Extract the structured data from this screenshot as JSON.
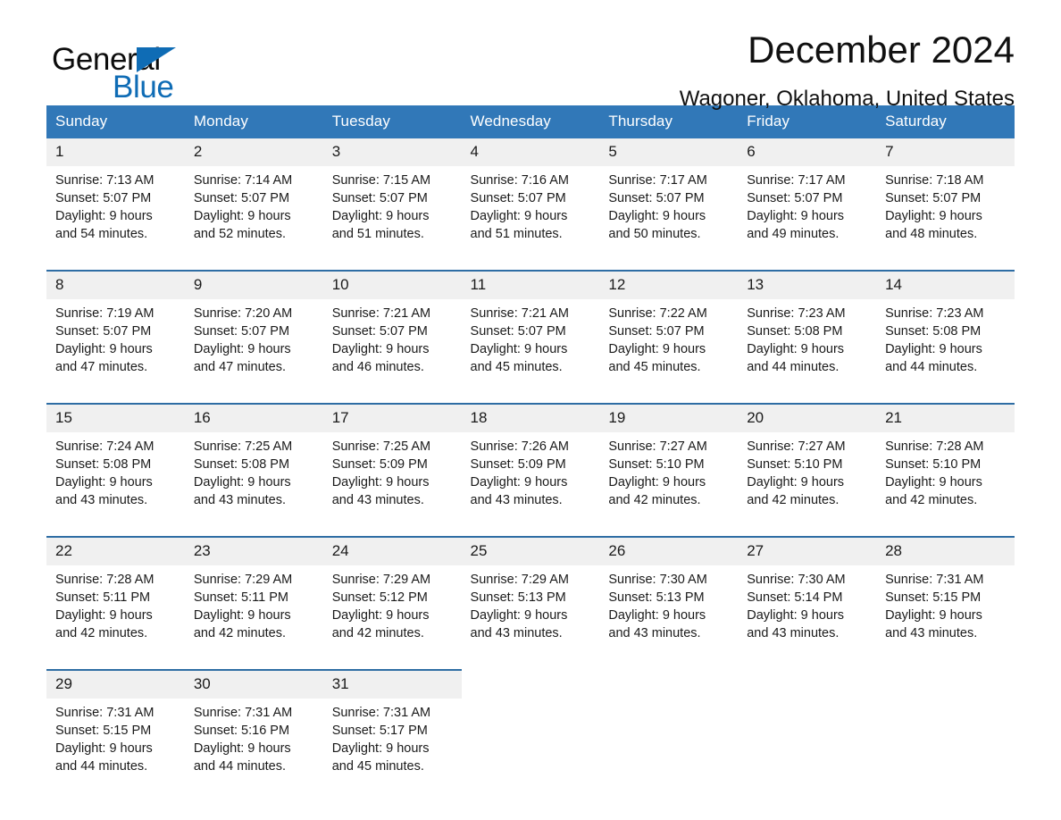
{
  "brand": {
    "name_part1": "General",
    "name_part2": "Blue",
    "flag_icon": "blue-triangle-flag"
  },
  "header": {
    "month_title": "December 2024",
    "location": "Wagoner, Oklahoma, United States"
  },
  "colors": {
    "header_blue": "#3178b8",
    "row_divider_blue": "#2e6da4",
    "daynum_background": "#f0f0f0",
    "brand_blue": "#0f6cb5"
  },
  "calendar": {
    "weekday_headers": [
      "Sunday",
      "Monday",
      "Tuesday",
      "Wednesday",
      "Thursday",
      "Friday",
      "Saturday"
    ],
    "weeks": [
      {
        "days": [
          {
            "date": "1",
            "sunrise": "Sunrise: 7:13 AM",
            "sunset": "Sunset: 5:07 PM",
            "daylight_line1": "Daylight: 9 hours",
            "daylight_line2": "and 54 minutes."
          },
          {
            "date": "2",
            "sunrise": "Sunrise: 7:14 AM",
            "sunset": "Sunset: 5:07 PM",
            "daylight_line1": "Daylight: 9 hours",
            "daylight_line2": "and 52 minutes."
          },
          {
            "date": "3",
            "sunrise": "Sunrise: 7:15 AM",
            "sunset": "Sunset: 5:07 PM",
            "daylight_line1": "Daylight: 9 hours",
            "daylight_line2": "and 51 minutes."
          },
          {
            "date": "4",
            "sunrise": "Sunrise: 7:16 AM",
            "sunset": "Sunset: 5:07 PM",
            "daylight_line1": "Daylight: 9 hours",
            "daylight_line2": "and 51 minutes."
          },
          {
            "date": "5",
            "sunrise": "Sunrise: 7:17 AM",
            "sunset": "Sunset: 5:07 PM",
            "daylight_line1": "Daylight: 9 hours",
            "daylight_line2": "and 50 minutes."
          },
          {
            "date": "6",
            "sunrise": "Sunrise: 7:17 AM",
            "sunset": "Sunset: 5:07 PM",
            "daylight_line1": "Daylight: 9 hours",
            "daylight_line2": "and 49 minutes."
          },
          {
            "date": "7",
            "sunrise": "Sunrise: 7:18 AM",
            "sunset": "Sunset: 5:07 PM",
            "daylight_line1": "Daylight: 9 hours",
            "daylight_line2": "and 48 minutes."
          }
        ]
      },
      {
        "days": [
          {
            "date": "8",
            "sunrise": "Sunrise: 7:19 AM",
            "sunset": "Sunset: 5:07 PM",
            "daylight_line1": "Daylight: 9 hours",
            "daylight_line2": "and 47 minutes."
          },
          {
            "date": "9",
            "sunrise": "Sunrise: 7:20 AM",
            "sunset": "Sunset: 5:07 PM",
            "daylight_line1": "Daylight: 9 hours",
            "daylight_line2": "and 47 minutes."
          },
          {
            "date": "10",
            "sunrise": "Sunrise: 7:21 AM",
            "sunset": "Sunset: 5:07 PM",
            "daylight_line1": "Daylight: 9 hours",
            "daylight_line2": "and 46 minutes."
          },
          {
            "date": "11",
            "sunrise": "Sunrise: 7:21 AM",
            "sunset": "Sunset: 5:07 PM",
            "daylight_line1": "Daylight: 9 hours",
            "daylight_line2": "and 45 minutes."
          },
          {
            "date": "12",
            "sunrise": "Sunrise: 7:22 AM",
            "sunset": "Sunset: 5:07 PM",
            "daylight_line1": "Daylight: 9 hours",
            "daylight_line2": "and 45 minutes."
          },
          {
            "date": "13",
            "sunrise": "Sunrise: 7:23 AM",
            "sunset": "Sunset: 5:08 PM",
            "daylight_line1": "Daylight: 9 hours",
            "daylight_line2": "and 44 minutes."
          },
          {
            "date": "14",
            "sunrise": "Sunrise: 7:23 AM",
            "sunset": "Sunset: 5:08 PM",
            "daylight_line1": "Daylight: 9 hours",
            "daylight_line2": "and 44 minutes."
          }
        ]
      },
      {
        "days": [
          {
            "date": "15",
            "sunrise": "Sunrise: 7:24 AM",
            "sunset": "Sunset: 5:08 PM",
            "daylight_line1": "Daylight: 9 hours",
            "daylight_line2": "and 43 minutes."
          },
          {
            "date": "16",
            "sunrise": "Sunrise: 7:25 AM",
            "sunset": "Sunset: 5:08 PM",
            "daylight_line1": "Daylight: 9 hours",
            "daylight_line2": "and 43 minutes."
          },
          {
            "date": "17",
            "sunrise": "Sunrise: 7:25 AM",
            "sunset": "Sunset: 5:09 PM",
            "daylight_line1": "Daylight: 9 hours",
            "daylight_line2": "and 43 minutes."
          },
          {
            "date": "18",
            "sunrise": "Sunrise: 7:26 AM",
            "sunset": "Sunset: 5:09 PM",
            "daylight_line1": "Daylight: 9 hours",
            "daylight_line2": "and 43 minutes."
          },
          {
            "date": "19",
            "sunrise": "Sunrise: 7:27 AM",
            "sunset": "Sunset: 5:10 PM",
            "daylight_line1": "Daylight: 9 hours",
            "daylight_line2": "and 42 minutes."
          },
          {
            "date": "20",
            "sunrise": "Sunrise: 7:27 AM",
            "sunset": "Sunset: 5:10 PM",
            "daylight_line1": "Daylight: 9 hours",
            "daylight_line2": "and 42 minutes."
          },
          {
            "date": "21",
            "sunrise": "Sunrise: 7:28 AM",
            "sunset": "Sunset: 5:10 PM",
            "daylight_line1": "Daylight: 9 hours",
            "daylight_line2": "and 42 minutes."
          }
        ]
      },
      {
        "days": [
          {
            "date": "22",
            "sunrise": "Sunrise: 7:28 AM",
            "sunset": "Sunset: 5:11 PM",
            "daylight_line1": "Daylight: 9 hours",
            "daylight_line2": "and 42 minutes."
          },
          {
            "date": "23",
            "sunrise": "Sunrise: 7:29 AM",
            "sunset": "Sunset: 5:11 PM",
            "daylight_line1": "Daylight: 9 hours",
            "daylight_line2": "and 42 minutes."
          },
          {
            "date": "24",
            "sunrise": "Sunrise: 7:29 AM",
            "sunset": "Sunset: 5:12 PM",
            "daylight_line1": "Daylight: 9 hours",
            "daylight_line2": "and 42 minutes."
          },
          {
            "date": "25",
            "sunrise": "Sunrise: 7:29 AM",
            "sunset": "Sunset: 5:13 PM",
            "daylight_line1": "Daylight: 9 hours",
            "daylight_line2": "and 43 minutes."
          },
          {
            "date": "26",
            "sunrise": "Sunrise: 7:30 AM",
            "sunset": "Sunset: 5:13 PM",
            "daylight_line1": "Daylight: 9 hours",
            "daylight_line2": "and 43 minutes."
          },
          {
            "date": "27",
            "sunrise": "Sunrise: 7:30 AM",
            "sunset": "Sunset: 5:14 PM",
            "daylight_line1": "Daylight: 9 hours",
            "daylight_line2": "and 43 minutes."
          },
          {
            "date": "28",
            "sunrise": "Sunrise: 7:31 AM",
            "sunset": "Sunset: 5:15 PM",
            "daylight_line1": "Daylight: 9 hours",
            "daylight_line2": "and 43 minutes."
          }
        ]
      },
      {
        "days": [
          {
            "date": "29",
            "sunrise": "Sunrise: 7:31 AM",
            "sunset": "Sunset: 5:15 PM",
            "daylight_line1": "Daylight: 9 hours",
            "daylight_line2": "and 44 minutes."
          },
          {
            "date": "30",
            "sunrise": "Sunrise: 7:31 AM",
            "sunset": "Sunset: 5:16 PM",
            "daylight_line1": "Daylight: 9 hours",
            "daylight_line2": "and 44 minutes."
          },
          {
            "date": "31",
            "sunrise": "Sunrise: 7:31 AM",
            "sunset": "Sunset: 5:17 PM",
            "daylight_line1": "Daylight: 9 hours",
            "daylight_line2": "and 45 minutes."
          },
          {
            "date": "",
            "sunrise": "",
            "sunset": "",
            "daylight_line1": "",
            "daylight_line2": ""
          },
          {
            "date": "",
            "sunrise": "",
            "sunset": "",
            "daylight_line1": "",
            "daylight_line2": ""
          },
          {
            "date": "",
            "sunrise": "",
            "sunset": "",
            "daylight_line1": "",
            "daylight_line2": ""
          },
          {
            "date": "",
            "sunrise": "",
            "sunset": "",
            "daylight_line1": "",
            "daylight_line2": ""
          }
        ]
      }
    ]
  }
}
